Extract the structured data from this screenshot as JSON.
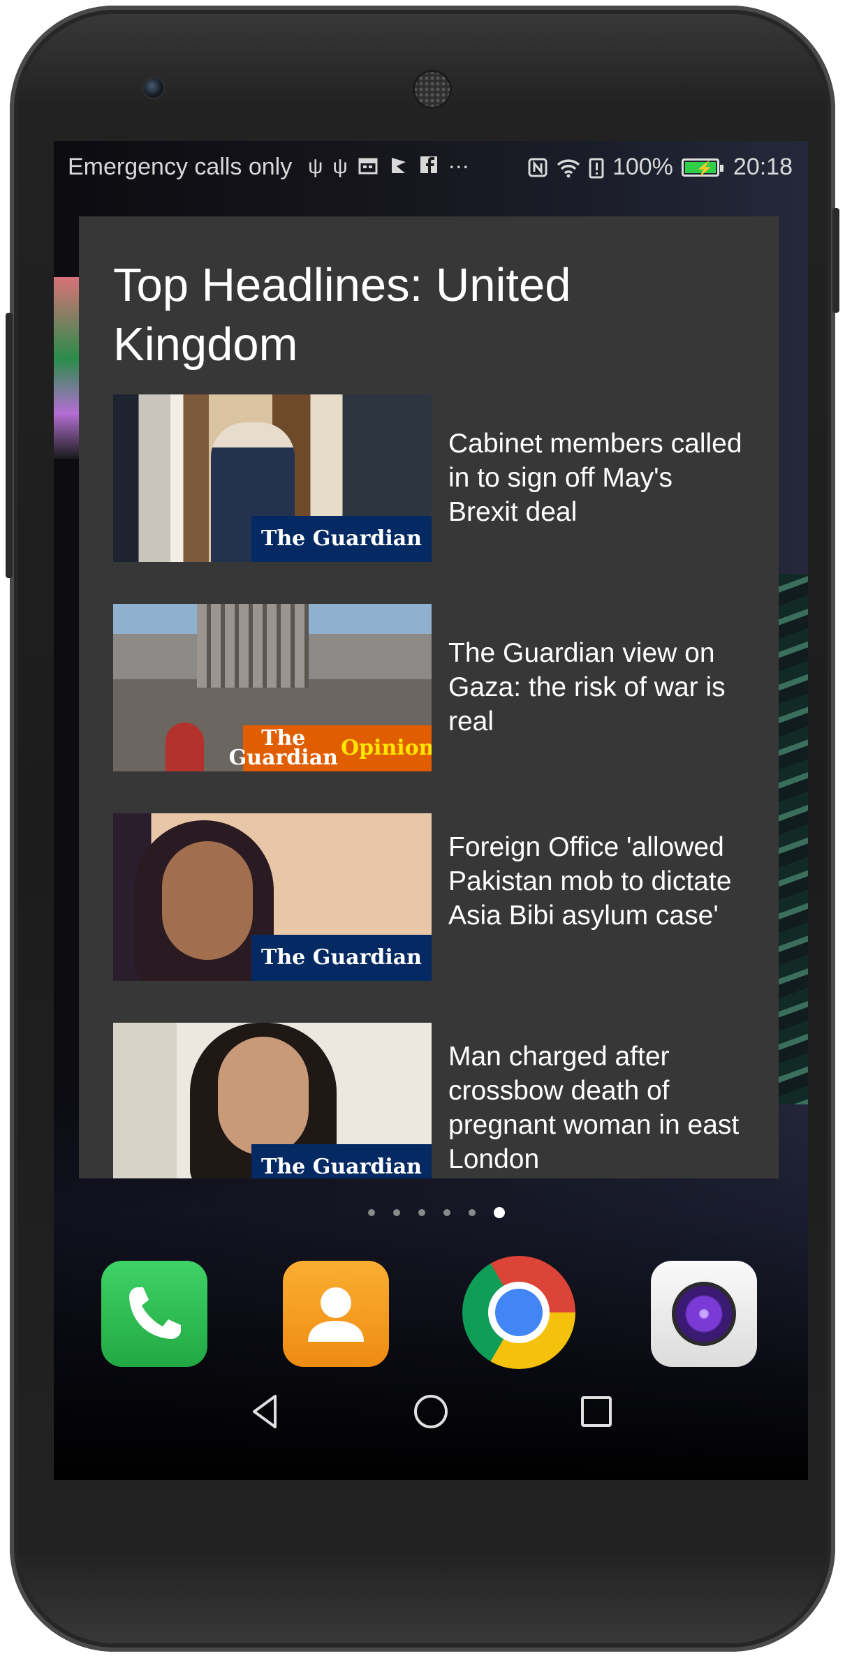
{
  "status_bar": {
    "carrier_text": "Emergency calls only",
    "icons_left": [
      "usb-icon",
      "usb-icon",
      "calendar-icon",
      "flag-icon",
      "facebook-icon",
      "more-icon"
    ],
    "battery_percent": "100%",
    "time": "20:18"
  },
  "widget": {
    "title": "Top Headlines: United Kingdom",
    "items": [
      {
        "headline": "Cabinet members called in to sign off May's Brexit deal",
        "source_badge": "The Guardian"
      },
      {
        "headline": "The Guardian view on Gaza: the risk of war is real",
        "source_badge": "The Guardian",
        "badge_extra": "Opinions"
      },
      {
        "headline": "Foreign Office 'allowed Pakistan mob to dictate Asia Bibi asylum case'",
        "source_badge": "The Guardian"
      },
      {
        "headline": "Man charged after crossbow death of pregnant woman in east London",
        "source_badge": "The Guardian"
      }
    ]
  },
  "page_indicator": {
    "total": 6,
    "active_index": 5
  },
  "dock": [
    {
      "name": "Phone",
      "icon": "phone-icon",
      "color": "#2bb84a"
    },
    {
      "name": "Contacts",
      "icon": "contacts-icon",
      "color": "#f29a1c"
    },
    {
      "name": "Chrome",
      "icon": "chrome-icon"
    },
    {
      "name": "Camera",
      "icon": "camera-icon"
    }
  ],
  "nav_bar": [
    "back-icon",
    "home-icon",
    "recents-icon"
  ]
}
